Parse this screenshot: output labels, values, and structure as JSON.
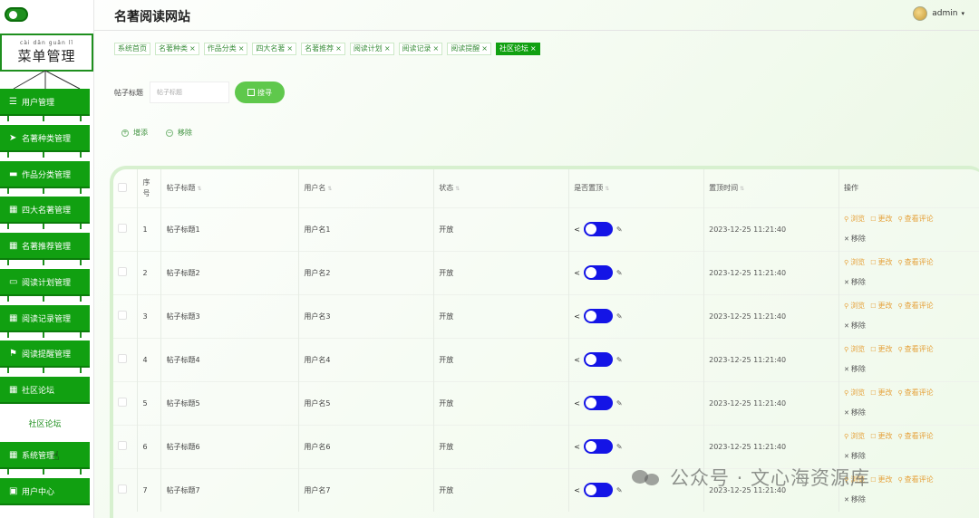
{
  "app": {
    "title": "名著阅读网站",
    "user": "admin"
  },
  "sidebar": {
    "header_pinyin": "cài dān guǎn lǐ",
    "header": "菜单管理",
    "items": [
      {
        "label": "用户管理",
        "icon": "list-icon"
      },
      {
        "label": "名著种类管理",
        "icon": "paper-plane-icon"
      },
      {
        "label": "作品分类管理",
        "icon": "ticket-icon"
      },
      {
        "label": "四大名著管理",
        "icon": "grid-icon"
      },
      {
        "label": "名著推荐管理",
        "icon": "grid-icon"
      },
      {
        "label": "阅读计划管理",
        "icon": "monitor-icon"
      },
      {
        "label": "阅读记录管理",
        "icon": "grid-icon"
      },
      {
        "label": "阅读提醒管理",
        "icon": "flag-icon"
      },
      {
        "label": "社区论坛",
        "icon": "grid-icon"
      },
      {
        "label": "系统管理",
        "icon": "grid-icon"
      },
      {
        "label": "用户中心",
        "icon": "window-icon"
      }
    ],
    "submenu": "社区论坛"
  },
  "tabs": [
    {
      "label": "系统首页",
      "closable": false
    },
    {
      "label": "名著种类",
      "closable": true
    },
    {
      "label": "作品分类",
      "closable": true
    },
    {
      "label": "四大名著",
      "closable": true
    },
    {
      "label": "名著推荐",
      "closable": true
    },
    {
      "label": "阅读计划",
      "closable": true
    },
    {
      "label": "阅读记录",
      "closable": true
    },
    {
      "label": "阅读提醒",
      "closable": true
    },
    {
      "label": "社区论坛",
      "closable": true,
      "active": true
    }
  ],
  "search": {
    "label": "帖子标题",
    "placeholder": "帖子标题",
    "button": "搜寻"
  },
  "actions": {
    "add": "增添",
    "remove": "移除"
  },
  "table": {
    "columns": [
      "序号",
      "帖子标题",
      "用户名",
      "状态",
      "是否置顶",
      "置顶时间",
      "操作"
    ],
    "rows": [
      {
        "idx": "1",
        "title": "帖子标题1",
        "user": "用户名1",
        "status": "开放",
        "time": "2023-12-25 11:21:40"
      },
      {
        "idx": "2",
        "title": "帖子标题2",
        "user": "用户名2",
        "status": "开放",
        "time": "2023-12-25 11:21:40"
      },
      {
        "idx": "3",
        "title": "帖子标题3",
        "user": "用户名3",
        "status": "开放",
        "time": "2023-12-25 11:21:40"
      },
      {
        "idx": "4",
        "title": "帖子标题4",
        "user": "用户名4",
        "status": "开放",
        "time": "2023-12-25 11:21:40"
      },
      {
        "idx": "5",
        "title": "帖子标题5",
        "user": "用户名5",
        "status": "开放",
        "time": "2023-12-25 11:21:40"
      },
      {
        "idx": "6",
        "title": "帖子标题6",
        "user": "用户名6",
        "status": "开放",
        "time": "2023-12-25 11:21:40"
      },
      {
        "idx": "7",
        "title": "帖子标题7",
        "user": "用户名7",
        "status": "开放",
        "time": "2023-12-25 11:21:40"
      }
    ],
    "ops": {
      "view": "浏览",
      "edit": "更改",
      "comments": "查看评论",
      "delete": "移除"
    }
  },
  "watermark": "公众号 · 文心海资源库",
  "colors": {
    "primary": "#11a011",
    "switch": "#1414e6",
    "op": "#e6a23c"
  }
}
